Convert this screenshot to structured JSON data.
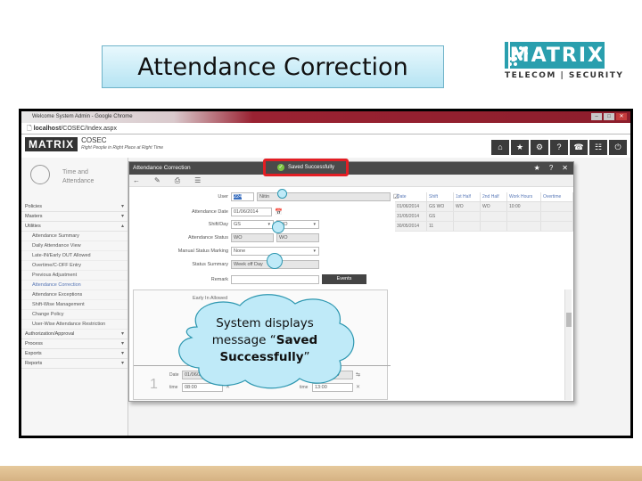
{
  "slide": {
    "title": "Attendance Correction",
    "logo": {
      "word": "MATRIX",
      "tagline": "TELECOM | SECURITY",
      "brand_color": "#2a9fae"
    },
    "callout": {
      "text_prefix": "System displays message “",
      "text_bold": "Saved Successfully",
      "text_suffix": "”"
    }
  },
  "browser": {
    "window_title": "Welcome System Admin - Google Chrome",
    "address": {
      "host": "localhost",
      "path": "/COSEC/Index.aspx"
    },
    "window_buttons": [
      "minimize",
      "maximize",
      "close"
    ]
  },
  "app": {
    "logo_word": "MATRIX",
    "name": "COSEC",
    "tagline": "Right People in Right Place at Right Time",
    "top_icons": [
      {
        "icon": "home-icon",
        "glyph": "⌂"
      },
      {
        "icon": "star-icon",
        "glyph": "★"
      },
      {
        "icon": "gear-icon",
        "glyph": "⚙"
      },
      {
        "icon": "help-icon",
        "glyph": "?"
      },
      {
        "icon": "phone-icon",
        "glyph": "☎"
      },
      {
        "icon": "org-chart-icon",
        "glyph": "☷"
      },
      {
        "icon": "power-icon",
        "glyph": "⏻"
      }
    ]
  },
  "sidebar": {
    "module": {
      "line1": "Time and",
      "line2": "Attendance"
    },
    "items": [
      {
        "label": "Policies",
        "arrow": "▾"
      },
      {
        "label": "Masters",
        "arrow": "▾"
      },
      {
        "label": "Utilities",
        "arrow": "▴"
      }
    ],
    "subitems": [
      {
        "label": "Attendance Summary"
      },
      {
        "label": "Daily Attendance View"
      },
      {
        "label": "Late-IN/Early OUT Allowed"
      },
      {
        "label": "Overtime/C-OFF Entry"
      },
      {
        "label": "Previous Adjustment"
      },
      {
        "label": "Attendance Correction",
        "active": true
      },
      {
        "label": "Attendance Exceptions"
      },
      {
        "label": "Shift-Wise Management"
      },
      {
        "label": "Change Policy"
      },
      {
        "label": "User-Wise Attendance Restriction"
      }
    ],
    "items_after": [
      {
        "label": "Authorization/Approval",
        "arrow": "▾"
      },
      {
        "label": "Process",
        "arrow": "▾"
      },
      {
        "label": "Exports",
        "arrow": "▾"
      },
      {
        "label": "Reports",
        "arrow": "▾"
      }
    ]
  },
  "panel": {
    "title": "Attendance Correction",
    "toast": "Saved Successfully",
    "header_buttons": {
      "star": "★",
      "help": "?",
      "close": "✕"
    },
    "toolbar": {
      "back": "←",
      "edit": "✎",
      "save": "⎙",
      "list": "☰"
    },
    "form": {
      "user_label": "User",
      "user_id": "224",
      "user_name": "Nitin",
      "date_label": "Attendance Date",
      "date_value": "01/06/2014",
      "shift_label": "Shift/Day",
      "shift_value": "GS",
      "day_value": "WO",
      "status_label": "Attendance Status",
      "status_1": "WO",
      "status_2": "WO",
      "manual_label": "Manual Status Marking",
      "manual_value": "None",
      "summary_label": "Status Summary",
      "summary_value": "Week off Day",
      "remark_label": "Remark",
      "remark_value": "",
      "events_button": "Events",
      "early_label": "Early In Allowed"
    },
    "grid": {
      "columns": [
        "Date",
        "Shift",
        "1st Half",
        "2nd Half",
        "Work Hours",
        "Overtime"
      ],
      "rows": [
        [
          "01/06/2014",
          "GS  WO",
          "WO",
          "WO",
          "10:00",
          ""
        ],
        [
          "31/05/2014",
          "GS",
          "",
          "",
          "",
          ""
        ],
        [
          "30/05/2014",
          "11",
          "",
          "",
          "",
          ""
        ]
      ]
    },
    "punch": {
      "index": "1",
      "date_label": "Date",
      "date_in": "01/06/2014",
      "date_out": "01/06/2014",
      "time_label": "time",
      "time_in": "08:00",
      "time_out": "13:00"
    }
  }
}
